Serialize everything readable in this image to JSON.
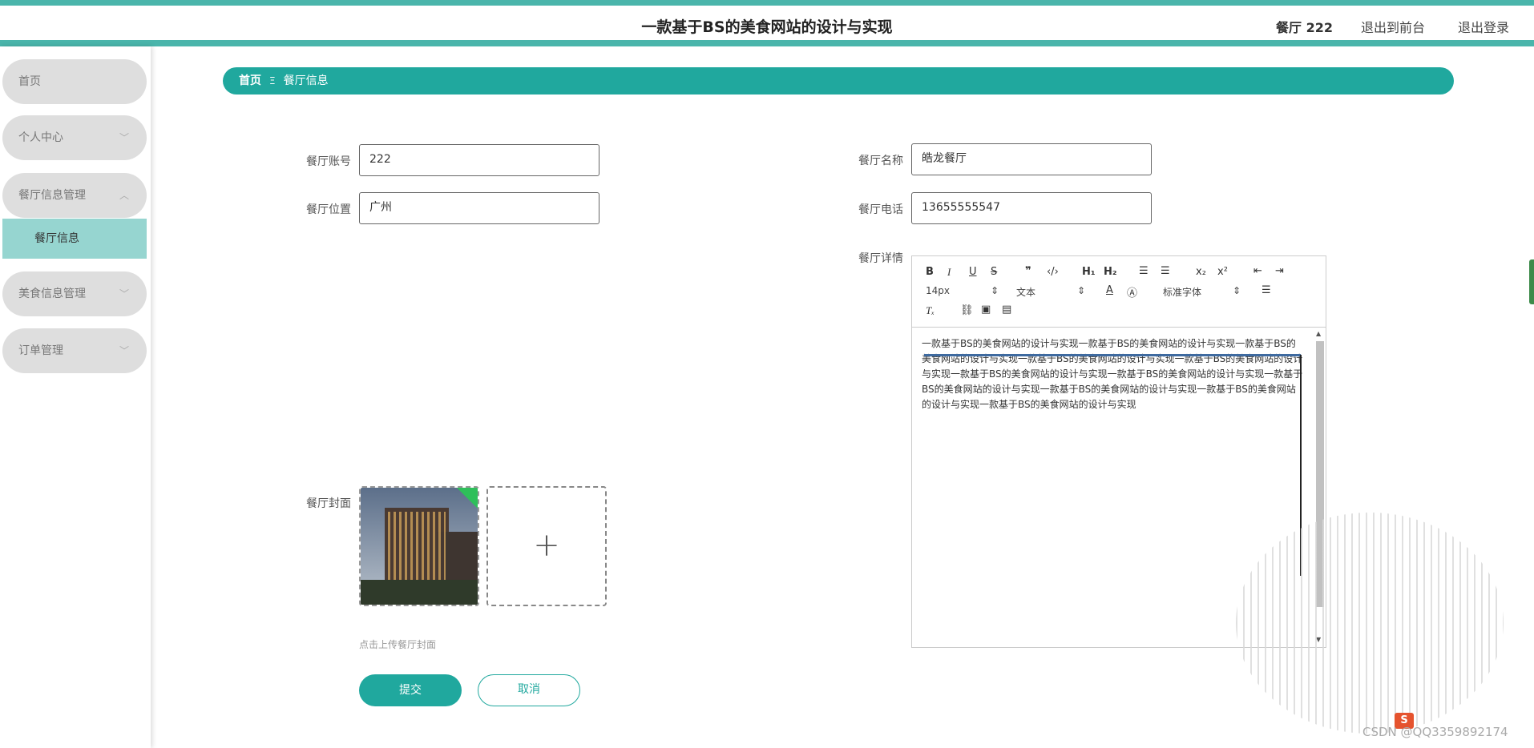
{
  "header": {
    "title": "一款基于BS的美食网站的设计与实现",
    "user": "餐厅 222",
    "to_front": "退出到前台",
    "logout": "退出登录"
  },
  "sidebar": {
    "items": [
      {
        "label": "首页"
      },
      {
        "label": "个人中心"
      },
      {
        "label": "餐厅信息管理"
      },
      {
        "label": "餐厅信息"
      },
      {
        "label": "美食信息管理"
      },
      {
        "label": "订单管理"
      }
    ]
  },
  "breadcrumb": {
    "home": "首页",
    "separator": "Ξ",
    "current": "餐厅信息"
  },
  "form": {
    "account_label": "餐厅账号",
    "account_value": "222",
    "name_label": "餐厅名称",
    "name_value": "皓龙餐厅",
    "location_label": "餐厅位置",
    "location_value": "广州",
    "phone_label": "餐厅电话",
    "phone_value": "13655555547",
    "detail_label": "餐厅详情",
    "cover_label": "餐厅封面",
    "cover_hint": "点击上传餐厅封面",
    "upload_plus": "+",
    "submit": "提交",
    "cancel": "取消"
  },
  "editor": {
    "font_size": "14px",
    "text_type": "文本",
    "font_family": "标准字体",
    "content": "一款基于BS的美食网站的设计与实现一款基于BS的美食网站的设计与实现一款基于BS的美食网站的设计与实现一款基于BS的美食网站的设计与实现一款基于BS的美食网站的设计与实现一款基于BS的美食网站的设计与实现一款基于BS的美食网站的设计与实现一款基于BS的美食网站的设计与实现一款基于BS的美食网站的设计与实现一款基于BS的美食网站的设计与实现一款基于BS的美食网站的设计与实现"
  },
  "watermark": "CSDN @QQ3359892174",
  "colors": {
    "accent": "#20a89e",
    "stripe": "#4ab5ab",
    "active_sub": "#96d5d0"
  }
}
